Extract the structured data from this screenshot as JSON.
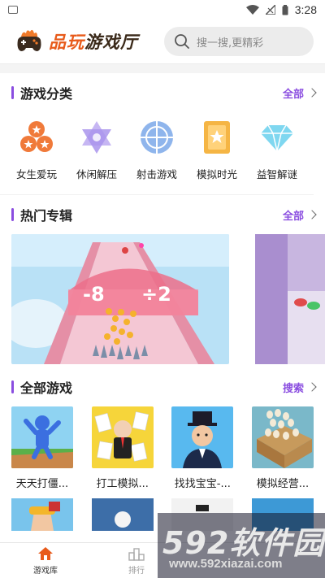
{
  "status_bar": {
    "time": "3:28"
  },
  "header": {
    "brand_a": "品玩",
    "brand_b": "游戏厅",
    "search_placeholder": "搜一搜,更精彩"
  },
  "categories_section": {
    "title": "游戏分类",
    "more": "全部",
    "items": [
      {
        "label": "女生爱玩",
        "icon": "coins-icon",
        "color": "#f07a3a"
      },
      {
        "label": "休闲解压",
        "icon": "star-of-david-icon",
        "color": "#b9a6f0"
      },
      {
        "label": "射击游戏",
        "icon": "crosshair-icon",
        "color": "#7fa9e6"
      },
      {
        "label": "模拟时光",
        "icon": "star-card-icon",
        "color": "#f5b544"
      },
      {
        "label": "益智解谜",
        "icon": "diamond-icon",
        "color": "#7fd7f0"
      }
    ]
  },
  "albums_section": {
    "title": "热门专辑",
    "more": "全部",
    "banner_text_a": "-8",
    "banner_text_b": "÷2"
  },
  "games_section": {
    "title": "全部游戏",
    "more": "搜索",
    "games": [
      {
        "name": "天天打僵..."
      },
      {
        "name": "打工模拟..."
      },
      {
        "name": "找找宝宝-..."
      },
      {
        "name": "模拟经营..."
      }
    ]
  },
  "bottom_nav": {
    "items": [
      {
        "label": "游戏库"
      },
      {
        "label": "排行"
      }
    ]
  },
  "watermark": {
    "big": "592软件园",
    "small": "www.592xiazai.com"
  },
  "colors": {
    "accent": "#8a4de0",
    "brand_orange": "#e85a1a"
  }
}
